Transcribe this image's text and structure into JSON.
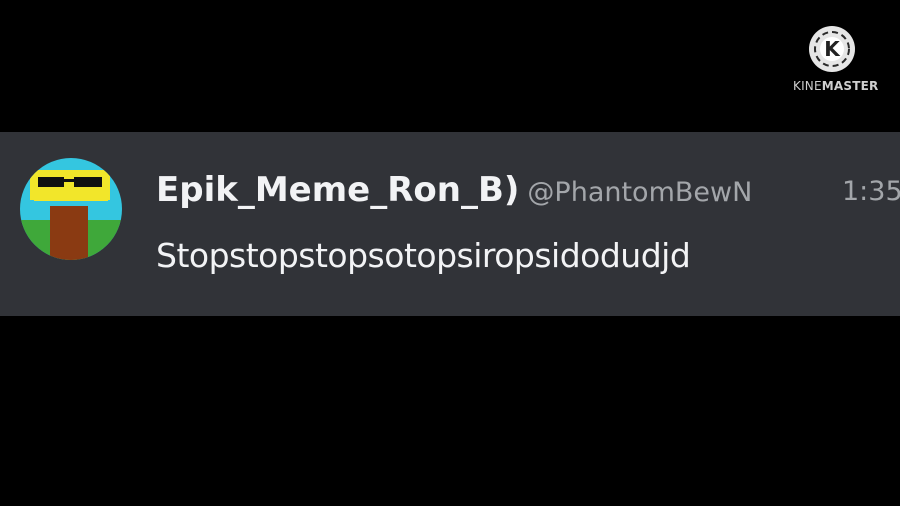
{
  "watermark": {
    "brand_prefix": "KINE",
    "brand_suffix": "MASTER",
    "logo_icon": "kinemaster-icon",
    "logo_letter": "K"
  },
  "message": {
    "username": "Epik_Meme_Ron_B)",
    "handle": "@PhantomBewN",
    "timestamp": "1:35",
    "text": "Stopstopstopsotopsiropsidodudjd",
    "avatar_icon": "avatar-image"
  },
  "colors": {
    "background": "#000000",
    "card": "#313338",
    "username": "#f2f3f5",
    "muted": "#a3a6aa"
  }
}
